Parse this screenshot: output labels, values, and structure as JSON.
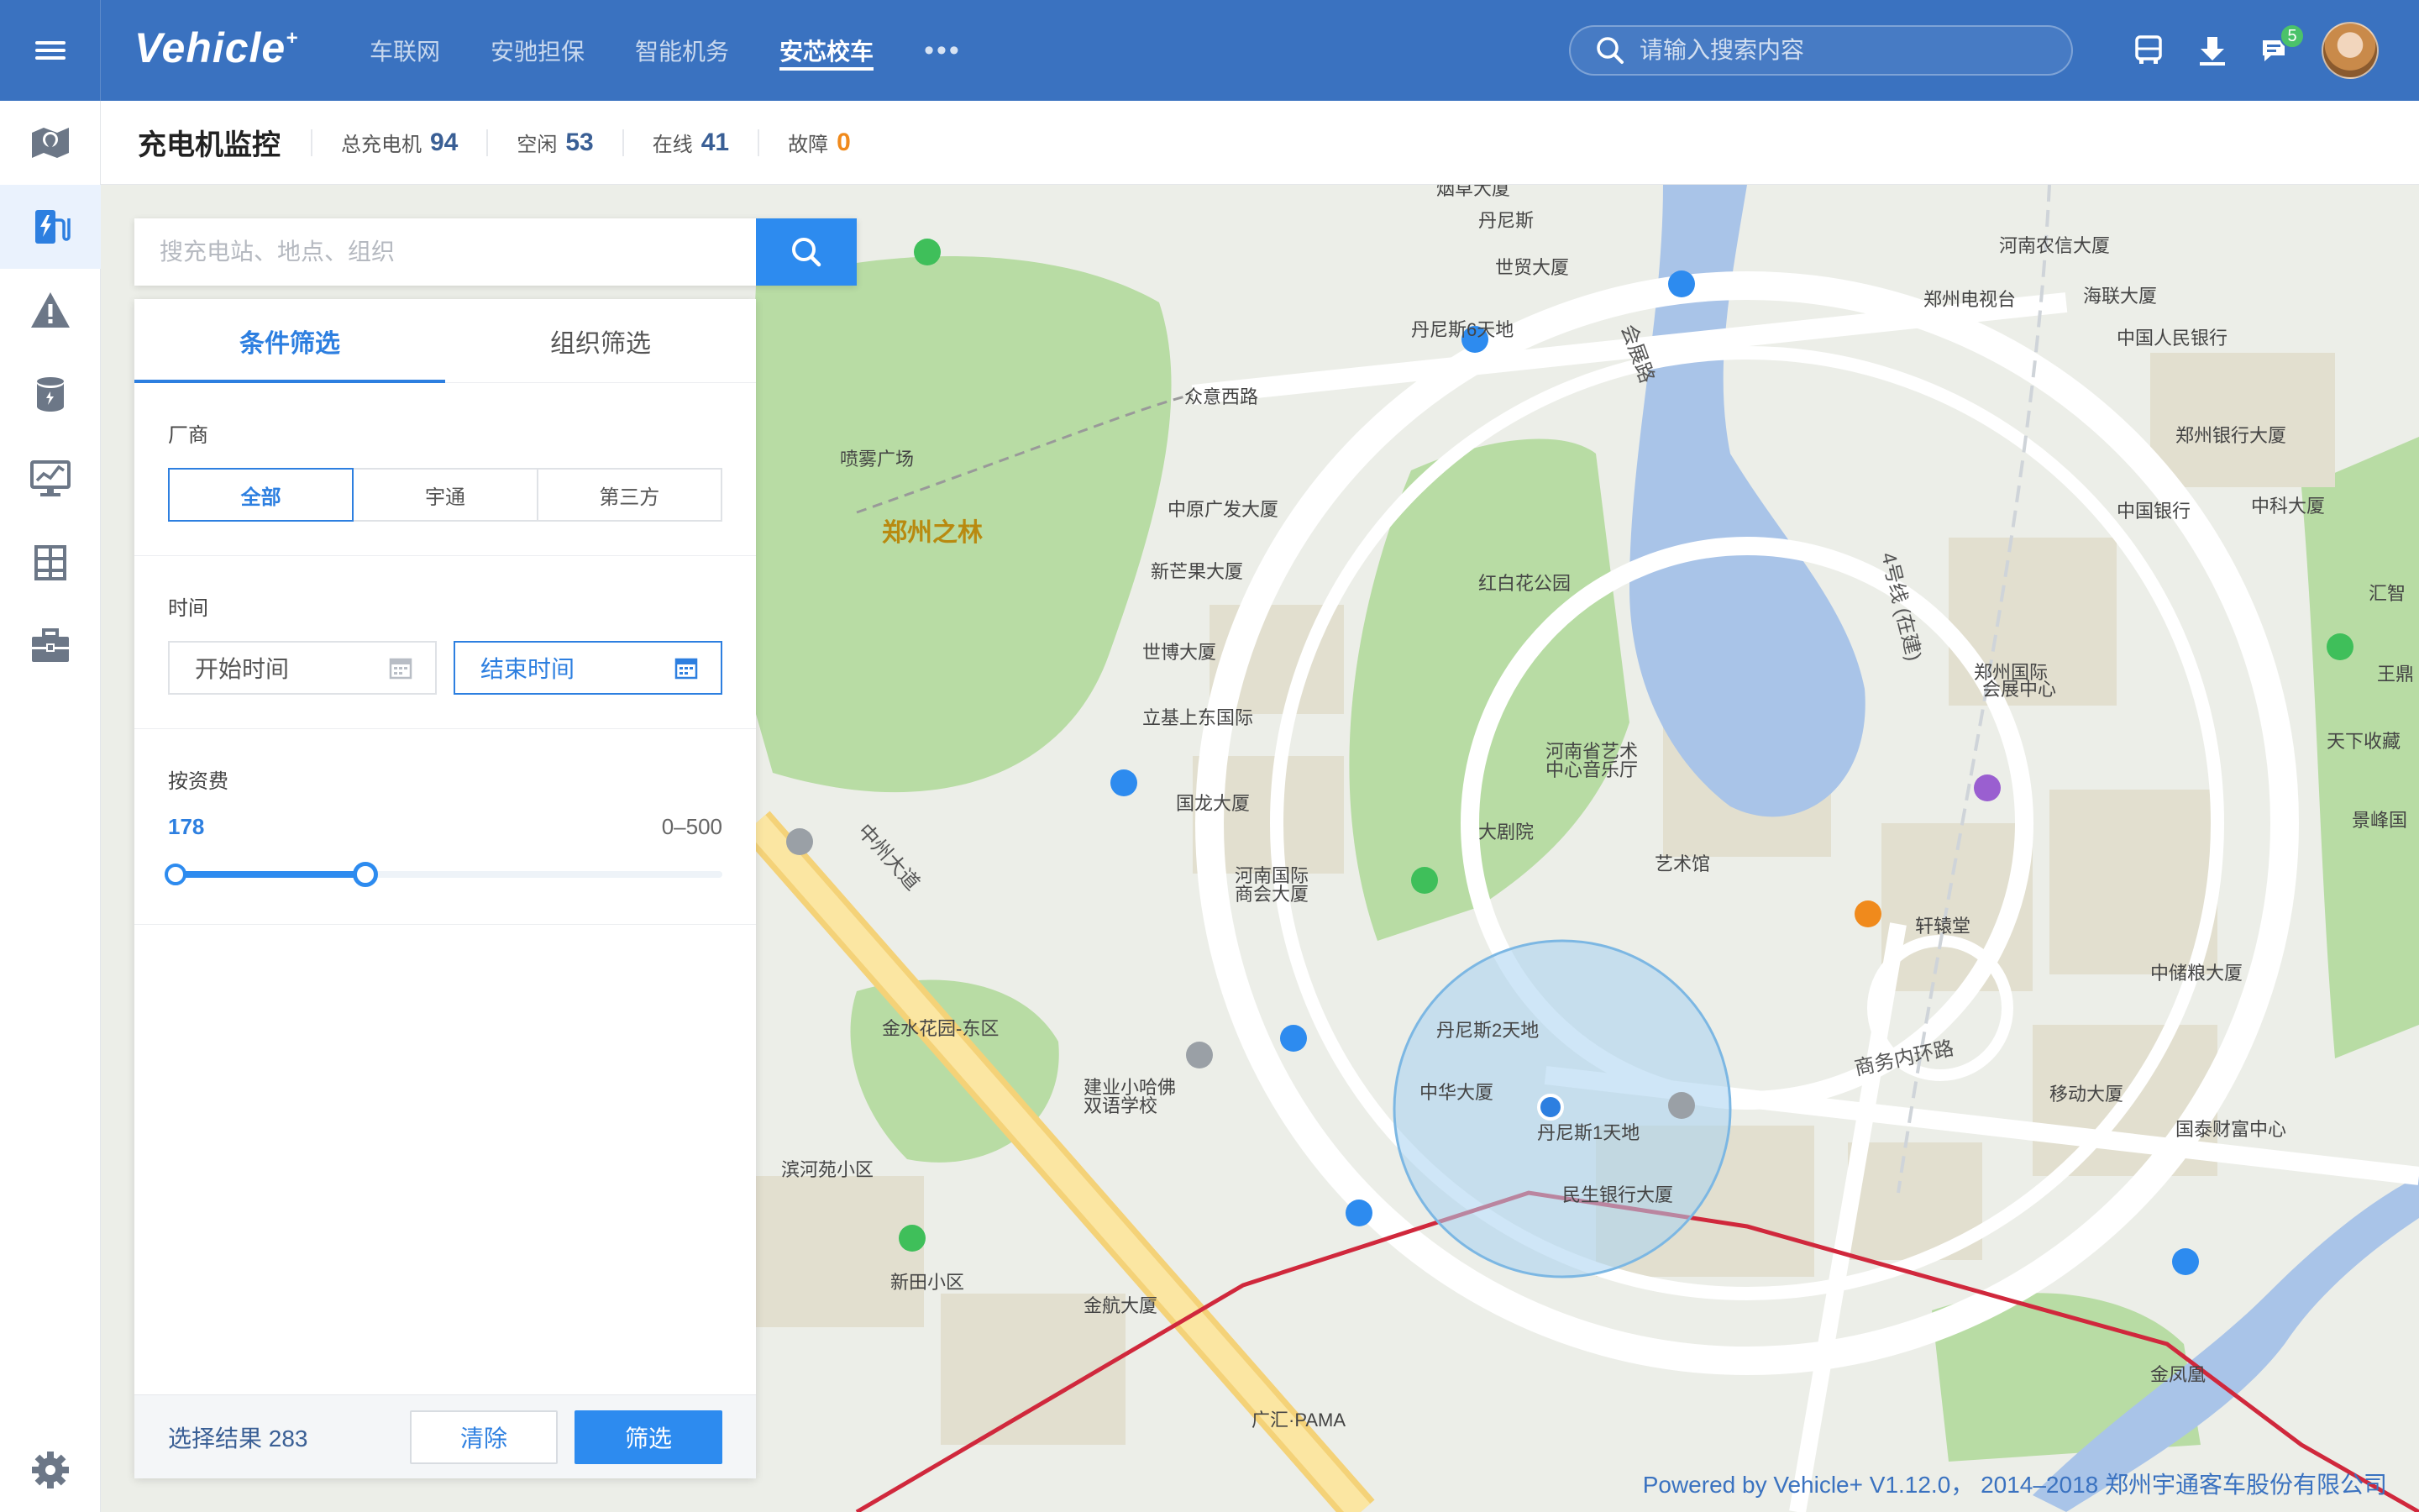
{
  "header": {
    "logo": "Vehicle",
    "logo_mark": "+",
    "nav": [
      {
        "label": "车联网",
        "active": false
      },
      {
        "label": "安驰担保",
        "active": false
      },
      {
        "label": "智能机务",
        "active": false
      },
      {
        "label": "安芯校车",
        "active": true
      }
    ],
    "more": "•••",
    "search_placeholder": "请输入搜索内容",
    "icons": [
      "bus-icon",
      "download-icon",
      "message-icon"
    ],
    "message_badge": "5"
  },
  "sidebar": {
    "items": [
      {
        "icon": "map-pin-icon",
        "active": false
      },
      {
        "icon": "charger-icon",
        "active": true
      },
      {
        "icon": "warning-icon",
        "active": false
      },
      {
        "icon": "database-icon",
        "active": false
      },
      {
        "icon": "monitor-chart-icon",
        "active": false
      },
      {
        "icon": "grid-icon",
        "active": false
      },
      {
        "icon": "briefcase-icon",
        "active": false
      }
    ],
    "settings_icon": "gear-icon"
  },
  "subheader": {
    "title": "充电机监控",
    "stats": [
      {
        "label": "总充电机",
        "value": "94"
      },
      {
        "label": "空闲",
        "value": "53"
      },
      {
        "label": "在线",
        "value": "41"
      },
      {
        "label": "故障",
        "value": "0"
      }
    ]
  },
  "panel": {
    "search_placeholder": "搜充电站、地点、组织",
    "tabs": [
      {
        "label": "条件筛选",
        "active": true
      },
      {
        "label": "组织筛选",
        "active": false
      }
    ],
    "vendor": {
      "label": "厂商",
      "options": [
        {
          "label": "全部",
          "active": true
        },
        {
          "label": "宇通",
          "active": false
        },
        {
          "label": "第三方",
          "active": false
        }
      ]
    },
    "time": {
      "label": "时间",
      "start": "开始时间",
      "end": "结束时间"
    },
    "fee": {
      "label": "按资费",
      "value": "178",
      "range_label": "0–500",
      "min": 0,
      "max": 500,
      "current": 178
    },
    "result_label": "选择结果 283",
    "clear": "清除",
    "filter": "筛选"
  },
  "map": {
    "labels": [
      "烟草大厦",
      "丹尼斯",
      "世贸大厦",
      "丹尼斯6天地",
      "众意西路",
      "喷雾广场",
      "郑州之林",
      "中原广发大厦",
      "新芒果大厦",
      "世博大厦",
      "立基上东国际",
      "国龙大厦",
      "河南国际",
      "商会大厦",
      "金水花园-东区",
      "建业小哈佛",
      "双语学校",
      "滨河苑小区",
      "新田小区",
      "金航大厦",
      "广汇·PAMA",
      "河南农信大厦",
      "郑州电视台",
      "海联大厦",
      "中国人民银行",
      "郑州银行大厦",
      "中国银行",
      "中科大厦",
      "汇智",
      "王鼎",
      "天下收藏",
      "景峰国",
      "郑州国际",
      "会展中心",
      "红白花公园",
      "河南省艺术",
      "中心音乐厅",
      "大剧院",
      "艺术馆",
      "轩辕堂",
      "中储粮大厦",
      "移动大厦",
      "国泰财富中心",
      "丹尼斯2天地",
      "中华大厦",
      "丹尼斯1天地",
      "民生银行大厦",
      "金凤凰",
      "中州大道",
      "会展路",
      "商务内环路",
      "4号线 (在建)"
    ],
    "copyright": "Powered by Vehicle+ V1.12.0， 2014–2018 郑州宇通客车股份有限公司"
  },
  "colors": {
    "brand": "#3a72c0",
    "accent": "#2d8bef",
    "warning": "#f08a1c",
    "water": "#a9c4e8",
    "park": "#b7dba4"
  }
}
